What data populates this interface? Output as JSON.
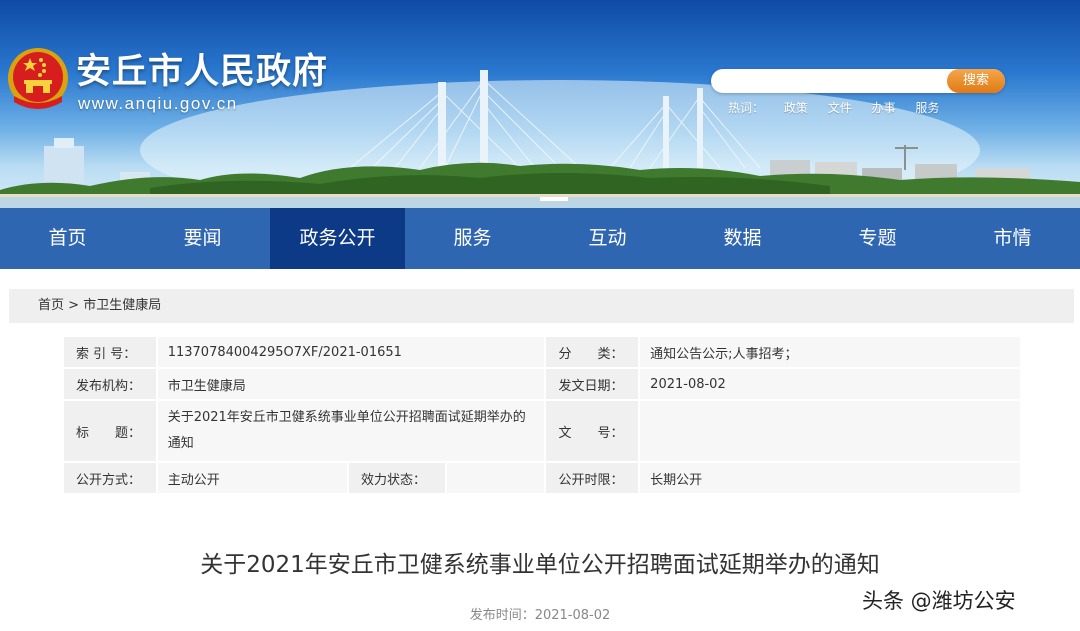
{
  "header": {
    "site_title": "安丘市人民政府",
    "site_url": "www.anqiu.gov.cn",
    "search": {
      "placeholder": "",
      "button_label": "搜索"
    },
    "hot_words": {
      "label": "热词：",
      "items": [
        "政策",
        "文件",
        "办事",
        "服务"
      ]
    },
    "colors": {
      "sky_top": "#0f4aa6",
      "search_button": "#e88a22"
    }
  },
  "nav": {
    "items": [
      "首页",
      "要闻",
      "政务公开",
      "服务",
      "互动",
      "数据",
      "专题",
      "市情"
    ],
    "active": "政务公开",
    "colors": {
      "bar": "#2f66b1",
      "active": "#0d3a86"
    }
  },
  "breadcrumb": {
    "home": "首页",
    "separator": ">",
    "current": "市卫生健康局"
  },
  "meta": {
    "index_no_label": "索 引 号：",
    "index_no": "11370784004295O7XF/2021-01651",
    "category_label": "分　　类：",
    "category": "通知公告公示;人事招考；",
    "publisher_label": "发布机构：",
    "publisher": "市卫生健康局",
    "issue_date_label": "发文日期：",
    "issue_date": "2021-08-02",
    "title_label": "标　　题：",
    "title": "关于2021年安丘市卫健系统事业单位公开招聘面试延期举办的通知",
    "doc_no_label": "文　　号：",
    "doc_no": "",
    "disclosure_label": "公开方式：",
    "disclosure": "主动公开",
    "validity_label": "效力状态：",
    "validity": "",
    "period_label": "公开时限：",
    "period": "长期公开"
  },
  "article": {
    "title": "关于2021年安丘市卫健系统事业单位公开招聘面试延期举办的通知",
    "publish_label": "发布时间：",
    "publish_date": "2021-08-02"
  },
  "watermark": "头条 @潍坊公安"
}
